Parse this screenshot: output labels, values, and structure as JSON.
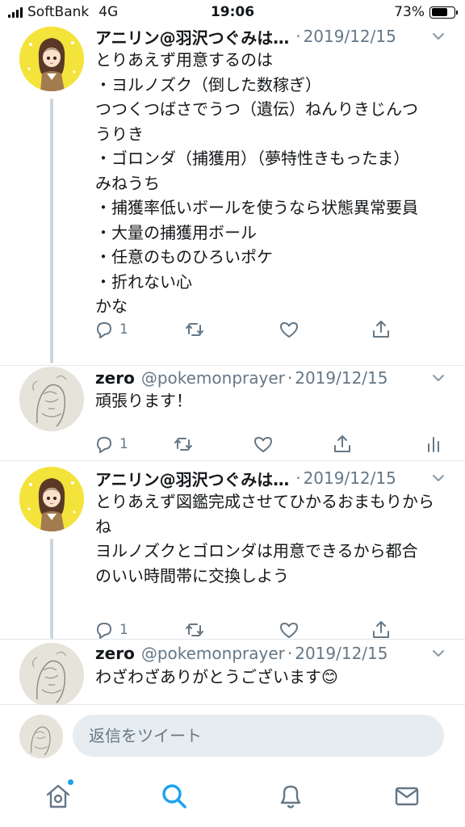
{
  "status_bar": {
    "carrier": "SoftBank",
    "network": "4G",
    "time": "19:06",
    "battery_percent_label": "73%",
    "battery_level": 0.73
  },
  "tweets": [
    {
      "display_name": "アニリン@羽沢つぐみは…",
      "handle": "",
      "date": "2019/12/15",
      "avatar": "anime-girl-avatar",
      "lines": [
        "とりあえず用意するのは",
        "・ヨルノズク（倒した数稼ぎ）",
        "つつくつばさでうつ（遺伝）ねんりきじんつ",
        "うりき",
        "・ゴロンダ（捕獲用）（夢特性きもったま）",
        "みねうち",
        "・捕獲率低いボールを使うなら状態異常要員",
        "・大量の捕獲用ボール",
        "・任意のものひろいポケ",
        "・折れない心",
        "かな"
      ],
      "reply_count": "1"
    },
    {
      "display_name": "zero",
      "handle": "@pokemonprayer",
      "date": "2019/12/15",
      "avatar": "sketch-avatar",
      "lines": [
        "頑張ります！"
      ],
      "reply_count": "1"
    },
    {
      "display_name": "アニリン@羽沢つぐみは…",
      "handle": "",
      "date": "2019/12/15",
      "avatar": "anime-girl-avatar",
      "lines": [
        "とりあえず図鑑完成させてひかるおまもりから",
        "ね",
        "ヨルノズクとゴロンダは用意できるから都合",
        "のいい時間帯に交換しよう"
      ],
      "reply_count": "1"
    },
    {
      "display_name": "zero",
      "handle": "@pokemonprayer",
      "date": "2019/12/15",
      "avatar": "sketch-avatar",
      "lines": [
        "わざわざありがとうございます😊"
      ],
      "reply_count": ""
    }
  ],
  "reply_bar": {
    "placeholder": "返信をツイート"
  },
  "tab_bar": {
    "items": [
      "home-icon",
      "search-icon",
      "bell-icon",
      "mail-icon"
    ],
    "active": "search-icon"
  },
  "colors": {
    "accent": "#1da1f2",
    "secondary_text": "#657786",
    "thread_line": "#ccd6dd"
  }
}
